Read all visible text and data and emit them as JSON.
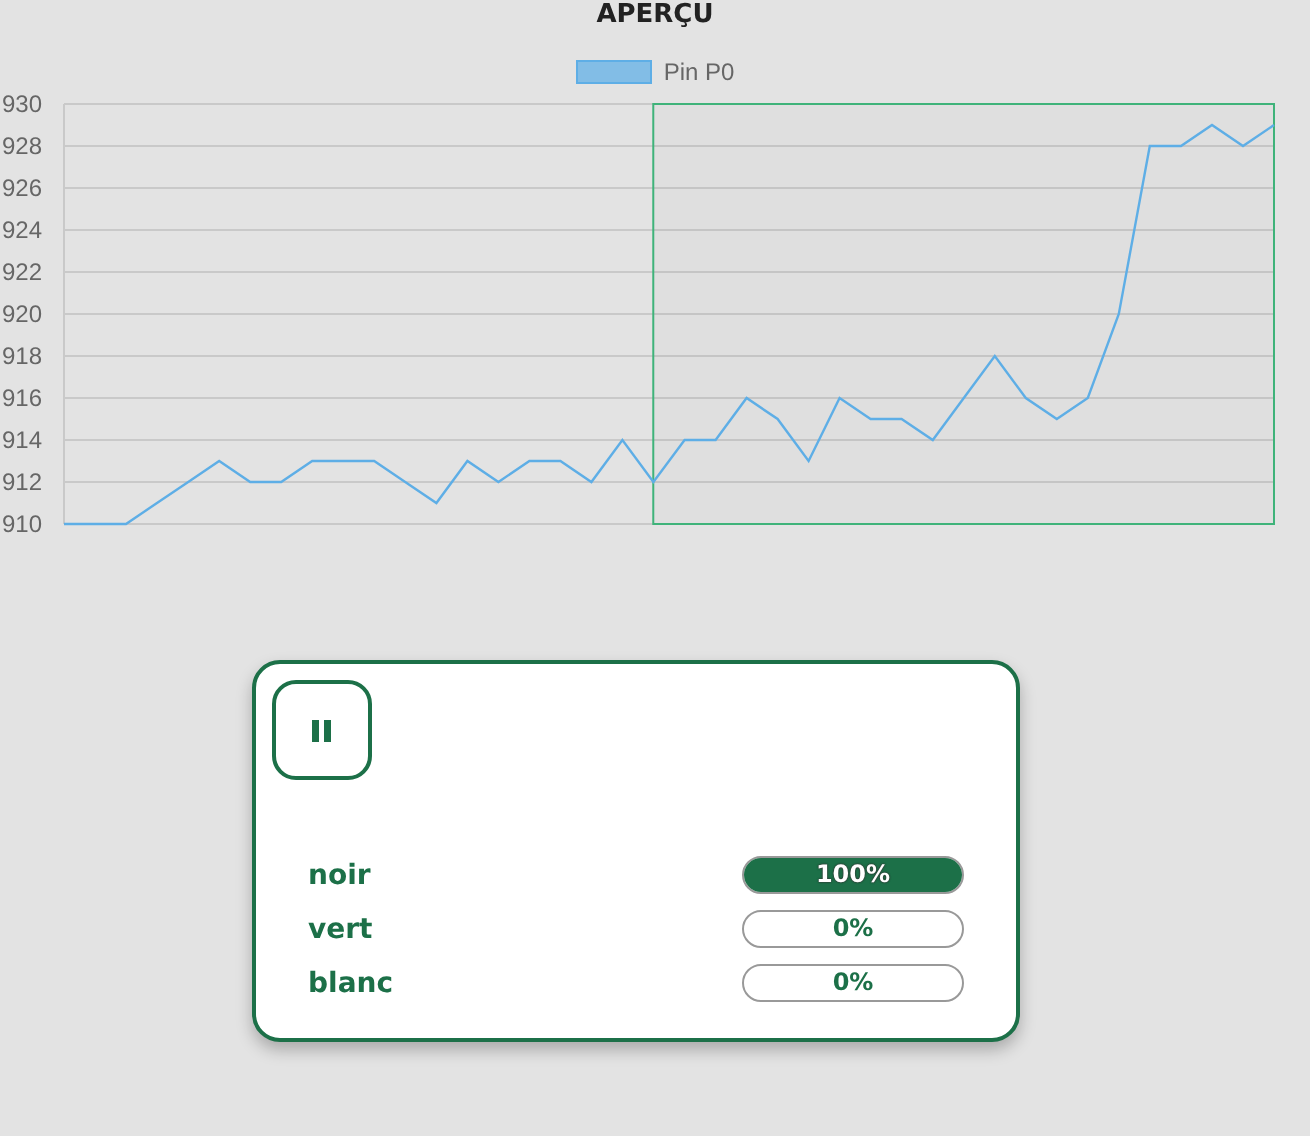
{
  "title": "APERÇU",
  "chart": {
    "chart_data": {
      "type": "line",
      "series": [
        {
          "name": "Pin P0",
          "color": "#5eaee6",
          "values": [
            910,
            910,
            910,
            911,
            912,
            913,
            912,
            912,
            913,
            913,
            913,
            912,
            911,
            913,
            912,
            913,
            913,
            912,
            914,
            912,
            914,
            914,
            916,
            915,
            913,
            916,
            915,
            915,
            914,
            916,
            918,
            916,
            915,
            916,
            920,
            928,
            928,
            929,
            928,
            929
          ]
        }
      ],
      "ylim": [
        910,
        930
      ],
      "yticks": [
        910,
        912,
        914,
        916,
        918,
        920,
        922,
        924,
        926,
        928,
        930
      ],
      "grid": true
    },
    "selection": {
      "level": 0.513
    }
  },
  "panel": {
    "pause_button": {
      "kind": "pause"
    },
    "channels": [
      {
        "name": "noir",
        "level": 1,
        "reading": "100%"
      },
      {
        "name": "vert",
        "level": 0,
        "reading": "0%"
      },
      {
        "name": "blanc",
        "level": 0,
        "reading": "0%"
      }
    ]
  }
}
